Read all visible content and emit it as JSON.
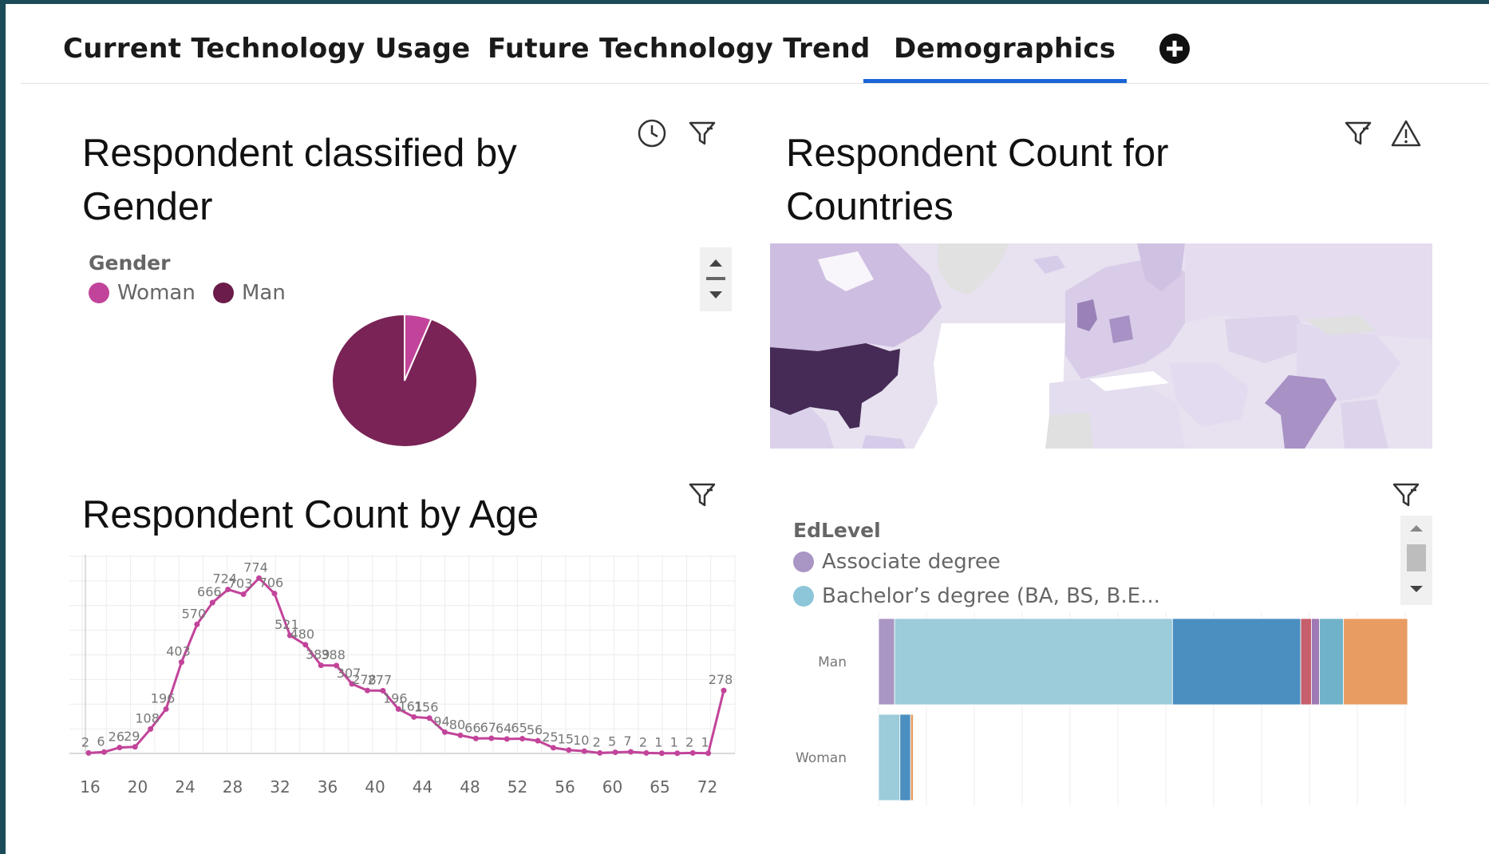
{
  "tabs": [
    {
      "label": "Current Technology Usage"
    },
    {
      "label": "Future Technology Trend"
    },
    {
      "label": "Demographics"
    }
  ],
  "active_tab": "Demographics",
  "tiles": {
    "gender": {
      "title_line1": "Respondent classified by",
      "title_line2": "Gender",
      "legend_title": "Gender",
      "legend": [
        {
          "label": "Woman",
          "color": "#c2449a"
        },
        {
          "label": "Man",
          "color": "#7a2356"
        }
      ]
    },
    "countries": {
      "title_line1": "Respondent Count for",
      "title_line2": "Countries"
    },
    "age": {
      "title": "Respondent Count by Age"
    },
    "edlevel": {
      "legend_title": "EdLevel",
      "legend": [
        {
          "label": "Associate degree",
          "color": "#a996c4"
        },
        {
          "label": "Bachelor’s degree (BA, BS, B.E...",
          "color": "#8ec6d9"
        }
      ]
    }
  },
  "icons": [
    "plus-circle-icon",
    "clock-icon",
    "filter-icon",
    "warning-icon",
    "scroll-up-icon",
    "scroll-down-icon"
  ],
  "chart_data": [
    {
      "type": "pie",
      "title": "Respondent classified by Gender",
      "slices": [
        {
          "label": "Woman",
          "value": 6,
          "color": "#c2449a"
        },
        {
          "label": "Man",
          "value": 94,
          "color": "#7a2356"
        }
      ]
    },
    {
      "type": "line",
      "title": "Respondent Count by Age",
      "color": "#c2449a",
      "x_ticks": [
        "16",
        "20",
        "24",
        "28",
        "32",
        "36",
        "40",
        "44",
        "48",
        "52",
        "56",
        "60",
        "65",
        "72"
      ],
      "points": [
        {
          "label": "2",
          "value": 2
        },
        {
          "label": "6",
          "value": 6
        },
        {
          "label": "26",
          "value": 26
        },
        {
          "label": "29",
          "value": 29
        },
        {
          "label": "108",
          "value": 108
        },
        {
          "label": "196",
          "value": 196
        },
        {
          "label": "403",
          "value": 403
        },
        {
          "label": "570",
          "value": 570
        },
        {
          "label": "666",
          "value": 666
        },
        {
          "label": "724",
          "value": 724
        },
        {
          "label": "703",
          "value": 703
        },
        {
          "label": "774",
          "value": 774
        },
        {
          "label": "706",
          "value": 706
        },
        {
          "label": "521",
          "value": 521
        },
        {
          "label": "480",
          "value": 480
        },
        {
          "label": "389",
          "value": 389
        },
        {
          "label": "388",
          "value": 388
        },
        {
          "label": "307",
          "value": 307
        },
        {
          "label": "278",
          "value": 278
        },
        {
          "label": "277",
          "value": 277
        },
        {
          "label": "196",
          "value": 196
        },
        {
          "label": "161",
          "value": 161
        },
        {
          "label": "156",
          "value": 156
        },
        {
          "label": "94",
          "value": 94
        },
        {
          "label": "80",
          "value": 80
        },
        {
          "label": "66",
          "value": 66
        },
        {
          "label": "67",
          "value": 67
        },
        {
          "label": "64",
          "value": 64
        },
        {
          "label": "65",
          "value": 65
        },
        {
          "label": "56",
          "value": 56
        },
        {
          "label": "25",
          "value": 25
        },
        {
          "label": "15",
          "value": 15
        },
        {
          "label": "10",
          "value": 10
        },
        {
          "label": "2",
          "value": 2
        },
        {
          "label": "5",
          "value": 5
        },
        {
          "label": "7",
          "value": 7
        },
        {
          "label": "2",
          "value": 2
        },
        {
          "label": "1",
          "value": 1
        },
        {
          "label": "1",
          "value": 1
        },
        {
          "label": "2",
          "value": 2
        },
        {
          "label": "1",
          "value": 1
        },
        {
          "label": "278",
          "value": 278
        }
      ]
    },
    {
      "type": "bar",
      "orientation": "horizontal-stacked",
      "categories": [
        "Man",
        "Woman"
      ],
      "series": [
        {
          "color": "#a996c4",
          "values": [
            3,
            0
          ]
        },
        {
          "name": "Bachelor’s degree (BA, BS, B.E...",
          "color": "#9ccbd9",
          "values": [
            52,
            4
          ]
        },
        {
          "color": "#4b8fc0",
          "values": [
            24,
            2
          ]
        },
        {
          "color": "#c55f6b",
          "values": [
            2,
            0
          ]
        },
        {
          "color": "#9e79b3",
          "values": [
            1.5,
            0
          ]
        },
        {
          "color": "#6fb2c9",
          "values": [
            4.5,
            0
          ]
        },
        {
          "color": "#e89c62",
          "values": [
            12,
            0.5
          ]
        }
      ]
    },
    {
      "type": "map",
      "title": "Respondent Count for Countries",
      "highlighted": [
        "United States",
        "India",
        "United Kingdom",
        "Germany"
      ]
    }
  ]
}
